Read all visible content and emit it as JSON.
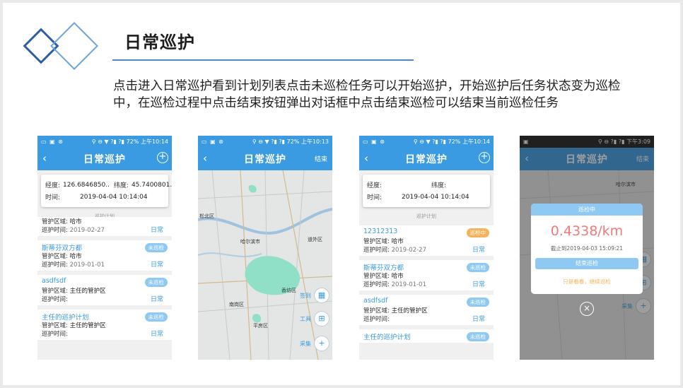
{
  "slide": {
    "title": "日常巡护",
    "description": "点击进入日常巡护看到计划列表点击未巡检任务可以开始巡护，开始巡护后任务状态变为巡检中，在巡检过程中点击结束按钮弹出对话框中点击结束巡检可以结束当前巡检任务"
  },
  "phone1": {
    "status_left": "▭ ▣ ⊛",
    "status_right": "⚲ ⊖ ▼ ?▮ ?▮ 72% 上午10:14",
    "title": "日常巡护",
    "lon_label": "经度:",
    "lon_value": "126.6846850..",
    "lat_label": "纬度:",
    "lat_value": "45.7400801..",
    "time_label": "时间:",
    "time_value": "2019-04-04 10:14:04",
    "plan_header": "巡护计划",
    "items": [
      {
        "name": "",
        "area_label": "管护区域:",
        "area": "哈市",
        "time_label": "巡护时间:",
        "time": "2019-02-27",
        "type": "日常",
        "status": ""
      },
      {
        "name": "斯蒂芬双方都",
        "area_label": "管护区域:",
        "area": "哈市",
        "time_label": "巡护时间:",
        "time": "2019-01-01",
        "type": "日常",
        "status": "未巡检"
      },
      {
        "name": "asdfsdf",
        "area_label": "管护区域:",
        "area": "主任的管护区",
        "time_label": "巡护时间:",
        "time": "",
        "type": "日常",
        "status": "未巡检"
      },
      {
        "name": "主任的巡护计划",
        "area_label": "管护区域:",
        "area": "主任的管护区",
        "time_label": "巡护时间:",
        "time": "",
        "type": "日常",
        "status": "未巡检"
      }
    ]
  },
  "phone2": {
    "status_left": "▭ ▣ ⊛",
    "status_right": "⚲ ⊖ ▼ ?▮ ?▮ 72% 上午10:13",
    "title": "日常巡护",
    "end_label": "结束",
    "map_labels": [
      "松北区",
      "哈尔滨市",
      "道外区",
      "香坊区",
      "南岗区",
      "平房区"
    ],
    "sign_label": "签到",
    "tool_label": "工具",
    "collect_label": "采集"
  },
  "phone3": {
    "status_left": "▭ ▣ ⊛",
    "status_right": "⚲ ⊖ ▼ ?▮ ?▮ 72% 上午10:14",
    "title": "日常巡护",
    "lon_label": "经度:",
    "lat_label": "纬度:",
    "time_label": "时间:",
    "time_value": "2019-04-04 10:14:04",
    "plan_header": "巡护计划",
    "items": [
      {
        "name": "12312313",
        "area_label": "管护区域:",
        "area": "哈市",
        "time_label": "巡护时间:",
        "time": "2019-02-27",
        "type": "日常",
        "status": "巡检中",
        "orange": true
      },
      {
        "name": "斯蒂芬双方都",
        "area_label": "管护区域:",
        "area": "哈市",
        "time_label": "巡护时间:",
        "time": "2019-01-01",
        "type": "日常",
        "status": "未巡检",
        "orange": false
      },
      {
        "name": "asdfsdf",
        "area_label": "管护区域:",
        "area": "主任的管护区",
        "time_label": "巡护时间:",
        "time": "",
        "type": "日常",
        "status": "未巡检",
        "orange": false
      },
      {
        "name": "主任的巡护计划",
        "area_label": "管护区域:",
        "area": "主任的管护区",
        "time_label": "",
        "time": "",
        "type": "",
        "status": "未巡检",
        "orange": false
      }
    ]
  },
  "phone4": {
    "status_right": "⚲ ⊖ ?▮ ?▮ 下午3:09",
    "title": "日常巡护",
    "end_label": "结束",
    "map_label": "哈尔滨市",
    "dialog_title": "巡检中",
    "speed": "0.4338/km",
    "until": "截止到2019-04-03 15:09:21",
    "end_button": "结束巡检",
    "continue_text": "只是看看，继续巡检",
    "close": "×",
    "sign_label": "签到",
    "tool_label": "工具",
    "collect_label": "采集"
  }
}
